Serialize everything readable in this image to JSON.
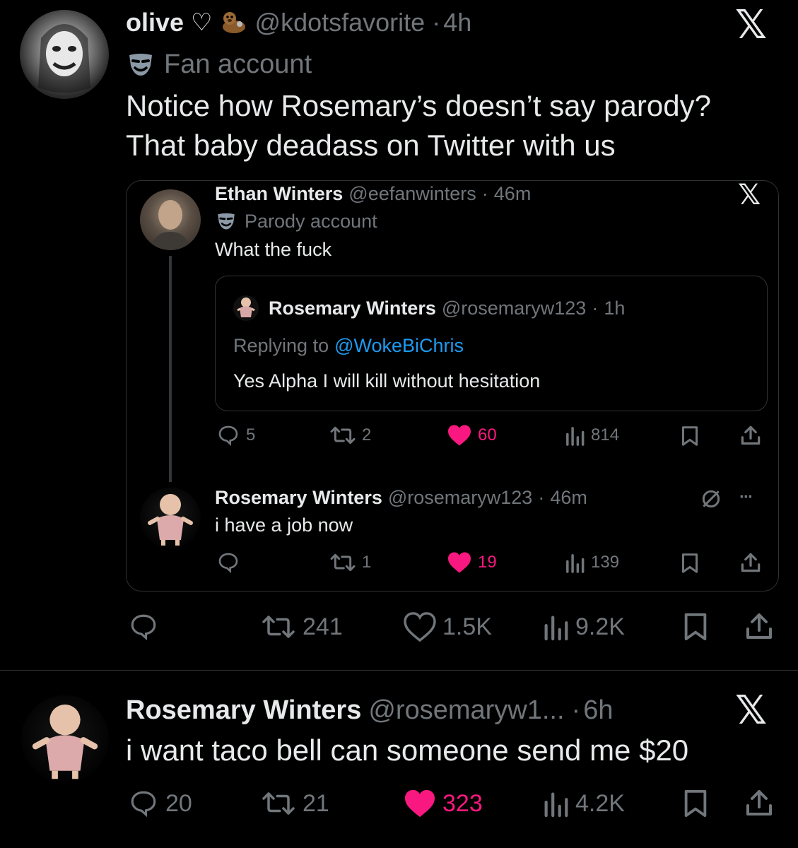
{
  "tweet1": {
    "name": "olive",
    "handle": "@kdotsfavorite",
    "time": "4h",
    "label": "Fan account",
    "text_line1": "Notice how Rosemary’s doesn’t say parody?",
    "text_line2": "That baby deadass on Twitter with us",
    "actions": {
      "retweets": "241",
      "likes": "1.5K",
      "views": "9.2K"
    }
  },
  "quote": {
    "name": "Ethan Winters",
    "handle": "@eefanwinters",
    "time": "46m",
    "label": "Parody account",
    "text": "What the fuck",
    "actions": {
      "replies": "5",
      "retweets": "2",
      "likes": "60",
      "views": "814"
    },
    "inner": {
      "name": "Rosemary Winters",
      "handle": "@rosemaryw123",
      "time": "1h",
      "replying_prefix": "Replying to",
      "replying_to": "@WokeBiChris",
      "text": "Yes Alpha I will kill without hesitation"
    },
    "reply": {
      "name": "Rosemary Winters",
      "handle": "@rosemaryw123",
      "time": "46m",
      "text": "i have a job now",
      "actions": {
        "retweets": "1",
        "likes": "19",
        "views": "139"
      }
    }
  },
  "tweet2": {
    "name": "Rosemary Winters",
    "handle": "@rosemaryw1...",
    "time": "6h",
    "text": "i want taco bell can someone send me $20",
    "actions": {
      "replies": "20",
      "retweets": "21",
      "likes": "323",
      "views": "4.2K"
    }
  },
  "glyphs": {
    "x_logo": "𝕏",
    "dot": "·",
    "heart_outline": "♡",
    "more": "···"
  },
  "icons": [
    "x-logo-icon",
    "mask-icon",
    "reply-icon",
    "retweet-icon",
    "heart-icon",
    "views-icon",
    "bookmark-icon",
    "share-icon",
    "otter-emoji-icon",
    "heart-outline-icon",
    "hidden-reply-icon",
    "more-icon"
  ],
  "colors": {
    "background": "#000000",
    "text": "#e7e9ea",
    "muted": "#71767b",
    "like_pink": "#f91880",
    "link_blue": "#1d9bf0",
    "border": "#2f3336"
  }
}
